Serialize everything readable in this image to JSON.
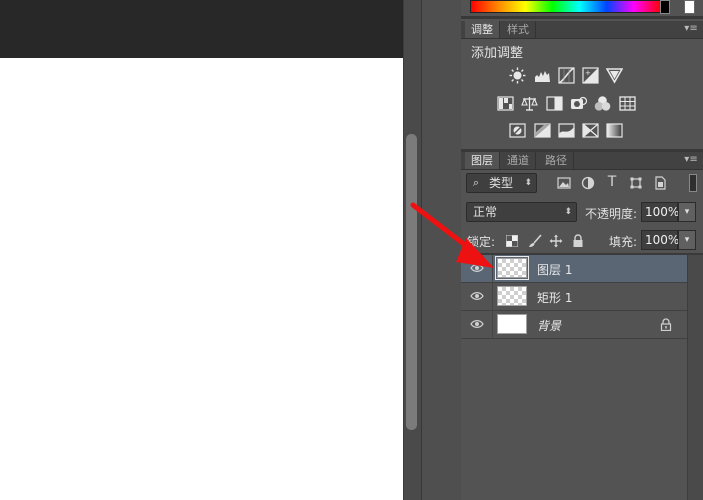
{
  "adjustments_panel": {
    "tabs": [
      {
        "label": "调整",
        "active": true
      },
      {
        "label": "样式",
        "active": false
      }
    ],
    "title": "添加调整",
    "icons_row1": [
      "brightness-contrast-icon",
      "levels-icon",
      "curves-icon",
      "exposure-icon",
      "vibrance-icon"
    ],
    "icons_row2": [
      "hue-saturation-icon",
      "color-balance-icon",
      "black-white-icon",
      "photo-filter-icon",
      "channel-mixer-icon",
      "color-lookup-icon"
    ],
    "icons_row3": [
      "invert-icon",
      "posterize-icon",
      "threshold-icon",
      "selective-color-icon",
      "gradient-map-icon"
    ]
  },
  "layers_panel": {
    "tabs": [
      {
        "label": "图层",
        "active": true
      },
      {
        "label": "通道",
        "active": false
      },
      {
        "label": "路径",
        "active": false
      }
    ],
    "filter_kind": "类型",
    "blend_mode": "正常",
    "opacity_label": "不透明度:",
    "opacity_value": "100%",
    "lock_label": "锁定:",
    "fill_label": "填充:",
    "fill_value": "100%",
    "layers": [
      {
        "name": "图层 1",
        "selected": true,
        "visible": true,
        "thumbnail": "transparent",
        "locked": false
      },
      {
        "name": "矩形 1",
        "selected": false,
        "visible": true,
        "thumbnail": "transparent",
        "locked": false
      },
      {
        "name": "背景",
        "selected": false,
        "visible": true,
        "thumbnail": "white",
        "locked": true
      }
    ]
  },
  "colors": {
    "canvas": "#ffffff",
    "panel_bg": "#535353",
    "selected_layer": "#5a6674",
    "annotation_arrow": "#ee1111"
  }
}
